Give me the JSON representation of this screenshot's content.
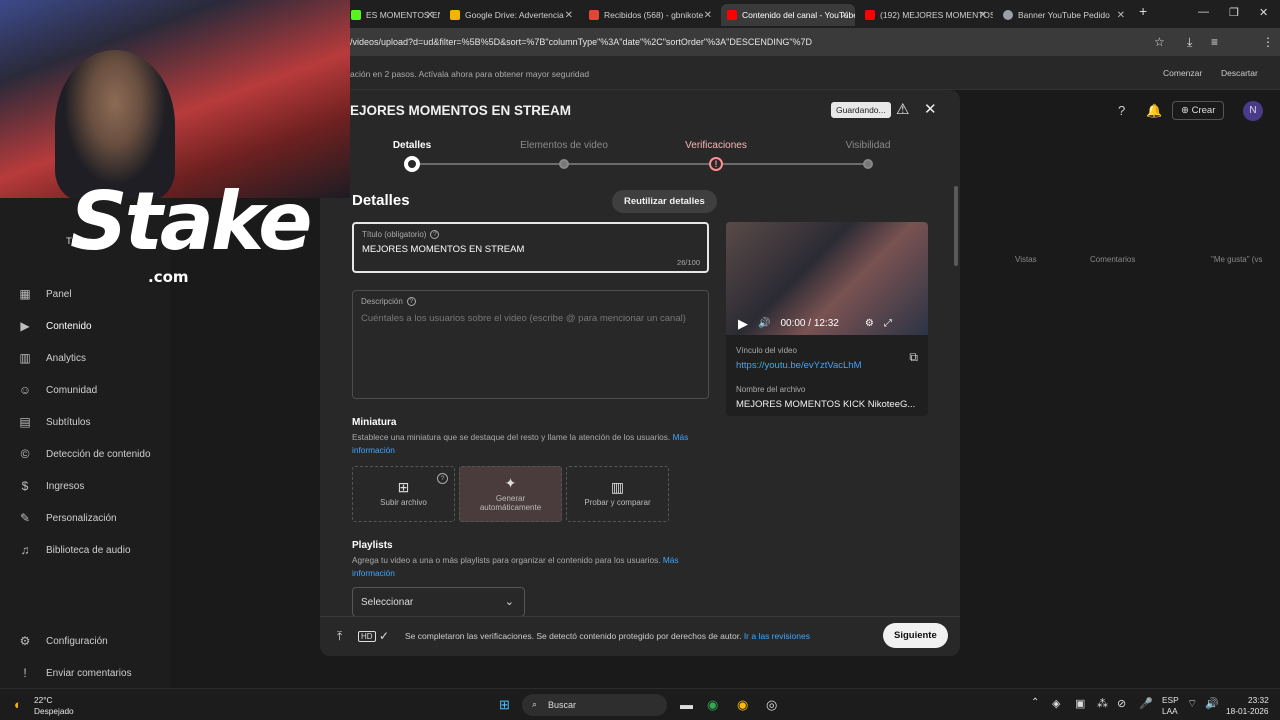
{
  "browser": {
    "tabs": [
      {
        "title": "ES MOMENTOS EN KICK",
        "color": "#53fc18"
      },
      {
        "title": "Google Drive: Advertencia",
        "color": "#f4b400"
      },
      {
        "title": "Recibidos (568) - gbnikote",
        "color": "#ea4335"
      },
      {
        "title": "Contenido del canal - YouTube",
        "color": "#ff0000"
      },
      {
        "title": "(192) MEJORES MOMENTOS",
        "color": "#ff0000"
      },
      {
        "title": "Banner YouTube Pedido",
        "color": "#9aa0a6"
      }
    ],
    "new_tab": "+",
    "url": "/videos/upload?d=ud&filter=%5B%5D&sort=%7B\"columnType\"%3A\"date\"%2C\"sortOrder\"%3A\"DESCENDING\"%7D",
    "profile_initial": "N"
  },
  "infobar": {
    "text": "ación en 2 pasos. Actívala ahora para obtener mayor seguridad",
    "start": "Comenzar",
    "dismiss": "Descartar"
  },
  "studio": {
    "create": "Crear",
    "avatar": "N",
    "channel_label": "Tu can",
    "columns": {
      "views": "Vistas",
      "comments": "Comentarios",
      "likes": "\"Me gusta\" (vs"
    },
    "nav": [
      {
        "label": "Panel",
        "icon": "dashboard-icon",
        "glyph": "▦"
      },
      {
        "label": "Contenido",
        "icon": "content-icon",
        "glyph": "▶"
      },
      {
        "label": "Analytics",
        "icon": "analytics-icon",
        "glyph": "▥"
      },
      {
        "label": "Comunidad",
        "icon": "community-icon",
        "glyph": "☺"
      },
      {
        "label": "Subtítulos",
        "icon": "subtitles-icon",
        "glyph": "▤"
      },
      {
        "label": "Detección de contenido",
        "icon": "copyright-icon",
        "glyph": "©"
      },
      {
        "label": "Ingresos",
        "icon": "earn-icon",
        "glyph": "$"
      },
      {
        "label": "Personalización",
        "icon": "customize-icon",
        "glyph": "✎"
      },
      {
        "label": "Biblioteca de audio",
        "icon": "audio-library-icon",
        "glyph": "♫"
      }
    ],
    "nav_bottom": [
      {
        "label": "Configuración",
        "icon": "settings-icon",
        "glyph": "⚙"
      },
      {
        "label": "Enviar comentarios",
        "icon": "feedback-icon",
        "glyph": "!"
      }
    ]
  },
  "modal": {
    "title": "EJORES MOMENTOS EN STREAM",
    "saving": "Guardando...",
    "steps": [
      {
        "label": "Detalles",
        "state": "active"
      },
      {
        "label": "Elementos de video",
        "state": "pending"
      },
      {
        "label": "Verificaciones",
        "state": "warning"
      },
      {
        "label": "Visibilidad",
        "state": "pending"
      }
    ],
    "section_title": "Detalles",
    "reuse_button": "Reutilizar detalles",
    "title_field": {
      "label": "Título (obligatorio)",
      "value": "MEJORES MOMENTOS EN STREAM",
      "counter": "26/100"
    },
    "description_field": {
      "label": "Descripción",
      "placeholder": "Cuéntales a los usuarios sobre el video (escribe @ para mencionar un canal)"
    },
    "thumbnail": {
      "title": "Miniatura",
      "desc": "Establece una miniatura que se destaque del resto y llame la atención de los usuarios.",
      "link": "Más información",
      "options": [
        "Subir archivo",
        "Generar automáticamente",
        "Probar y comparar"
      ]
    },
    "playlists": {
      "title": "Playlists",
      "desc": "Agrega tu video a una o más playlists para organizar el contenido para los usuarios.",
      "link": "Más información",
      "select": "Seleccionar"
    },
    "preview": {
      "time": "00:00 / 12:32",
      "link_label": "Vínculo del video",
      "link": "https://youtu.be/evYztVacLhM",
      "file_label": "Nombre del archivo",
      "file": "MEJORES MOMENTOS KICK NikoteeG..."
    },
    "footer": {
      "status": "Se completaron las verificaciones. Se detectó contenido protegido por derechos de autor.",
      "link": "Ir a las revisiones",
      "next": "Siguiente"
    }
  },
  "overlay": {
    "brand": "Stake",
    "brand_domain": ".com"
  },
  "taskbar": {
    "temp": "22°C",
    "weather": "Despejado",
    "search": "Buscar",
    "lang": "ESP",
    "lang2": "LAA",
    "time": "23:32",
    "date": "18-01-2026"
  }
}
